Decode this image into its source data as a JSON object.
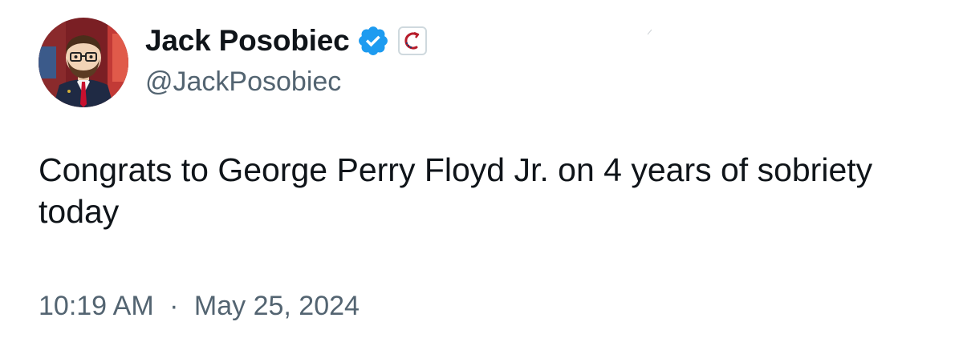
{
  "tweet": {
    "author": {
      "display_name": "Jack Posobiec",
      "handle": "@JackPosobiec",
      "avatar_icon": "cartoon-portrait-avatar",
      "verified_icon": "verified-check-icon",
      "verified_color": "#1d9bf0",
      "affiliate_icon": "organization-affiliate-badge-icon",
      "affiliate_color": "#b71c2b"
    },
    "text": "Congrats to George Perry Floyd Jr. on 4 years of sobriety today",
    "time": "10:19 AM",
    "separator": "·",
    "date": "May 25, 2024"
  },
  "colors": {
    "primary_text": "#0f1419",
    "secondary_text": "#536471",
    "background": "#ffffff"
  }
}
